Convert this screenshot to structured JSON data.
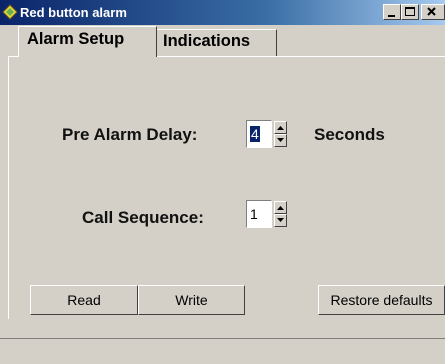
{
  "window": {
    "title": "Red button alarm",
    "icon": "diamond-app-icon"
  },
  "tabs": [
    {
      "label": "Alarm Setup",
      "active": true
    },
    {
      "label": "Indications",
      "active": false
    }
  ],
  "fields": {
    "pre_alarm_delay": {
      "label": "Pre Alarm Delay:",
      "value": "4",
      "unit": "Seconds"
    },
    "call_sequence": {
      "label": "Call Sequence:",
      "value": "1"
    }
  },
  "buttons": {
    "read": "Read",
    "write": "Write",
    "restore": "Restore defaults"
  }
}
